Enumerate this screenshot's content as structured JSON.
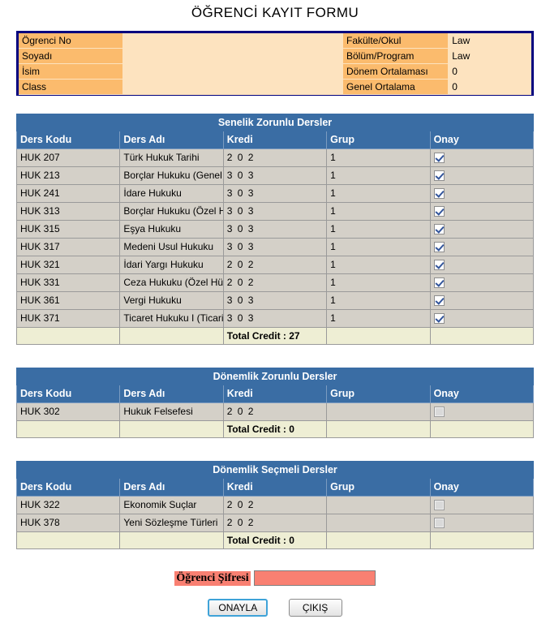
{
  "page": {
    "title": "ÖĞRENCİ KAYIT FORMU"
  },
  "student_info": {
    "left_labels": [
      "Ögrenci No",
      "Soyadı",
      "İsim",
      "Class"
    ],
    "left_values": [
      "",
      "",
      "",
      ""
    ],
    "right_rows": [
      {
        "label": "Fakülte/Okul",
        "value": "Law"
      },
      {
        "label": "Bölüm/Program",
        "value": "Law"
      },
      {
        "label": "Dönem Ortalaması",
        "value": "0"
      },
      {
        "label": "Genel Ortalama",
        "value": "0"
      }
    ]
  },
  "columns": {
    "code": "Ders Kodu",
    "name": "Ders Adı",
    "credit": "Kredi",
    "group": "Grup",
    "approve": "Onay"
  },
  "tables": [
    {
      "title": "Senelik Zorunlu Dersler",
      "rows": [
        {
          "code": "HUK 207",
          "name": "Türk Hukuk Tarihi",
          "credit": "2 0 2",
          "group": "1",
          "checked": true
        },
        {
          "code": "HUK 213",
          "name": "Borçlar Hukuku (Genel Hükümler)",
          "credit": "3 0 3",
          "group": "1",
          "checked": true
        },
        {
          "code": "HUK 241",
          "name": "İdare Hukuku",
          "credit": "3 0 3",
          "group": "1",
          "checked": true
        },
        {
          "code": "HUK 313",
          "name": "Borçlar Hukuku (Özel Hükümler)",
          "credit": "3 0 3",
          "group": "1",
          "checked": true
        },
        {
          "code": "HUK 315",
          "name": "Eşya Hukuku",
          "credit": "3 0 3",
          "group": "1",
          "checked": true
        },
        {
          "code": "HUK 317",
          "name": "Medeni Usul Hukuku",
          "credit": "3 0 3",
          "group": "1",
          "checked": true
        },
        {
          "code": "HUK 321",
          "name": "İdari Yargı Hukuku",
          "credit": "2 0 2",
          "group": "1",
          "checked": true
        },
        {
          "code": "HUK 331",
          "name": "Ceza Hukuku (Özel Hükümler)",
          "credit": "2 0 2",
          "group": "1",
          "checked": true
        },
        {
          "code": "HUK 361",
          "name": "Vergi Hukuku",
          "credit": "3 0 3",
          "group": "1",
          "checked": true
        },
        {
          "code": "HUK 371",
          "name": "Ticaret Hukuku I (Ticari İşletme-Şirketler Huk.)",
          "credit": "3 0 3",
          "group": "1",
          "checked": true
        }
      ],
      "total": "Total Credit : 27"
    },
    {
      "title": "Dönemlik Zorunlu Dersler",
      "rows": [
        {
          "code": "HUK 302",
          "name": "Hukuk Felsefesi",
          "credit": "2 0 2",
          "group": "",
          "checked": false
        }
      ],
      "total": "Total Credit : 0"
    },
    {
      "title": "Dönemlik Seçmeli Dersler",
      "rows": [
        {
          "code": "HUK 322",
          "name": "Ekonomik Suçlar",
          "credit": "2 0 2",
          "group": "",
          "checked": false
        },
        {
          "code": "HUK 378",
          "name": "Yeni Sözleşme Türleri",
          "credit": "2 0 2",
          "group": "",
          "checked": false
        }
      ],
      "total": "Total Credit : 0"
    }
  ],
  "password": {
    "label": "Öğrenci Şifresi",
    "value": "",
    "placeholder": ""
  },
  "buttons": {
    "submit": "ONAYLA",
    "exit": "ÇIKIŞ"
  },
  "colors": {
    "header_blue": "#3a6da4",
    "info_border": "#00007e",
    "info_label": "#fbbb6d",
    "info_bg": "#fde3bf",
    "row_bg": "#d4d0c8",
    "total_bg": "#eeeed4",
    "password_salmon": "#f98072",
    "focus_blue": "#3fa3d8"
  }
}
